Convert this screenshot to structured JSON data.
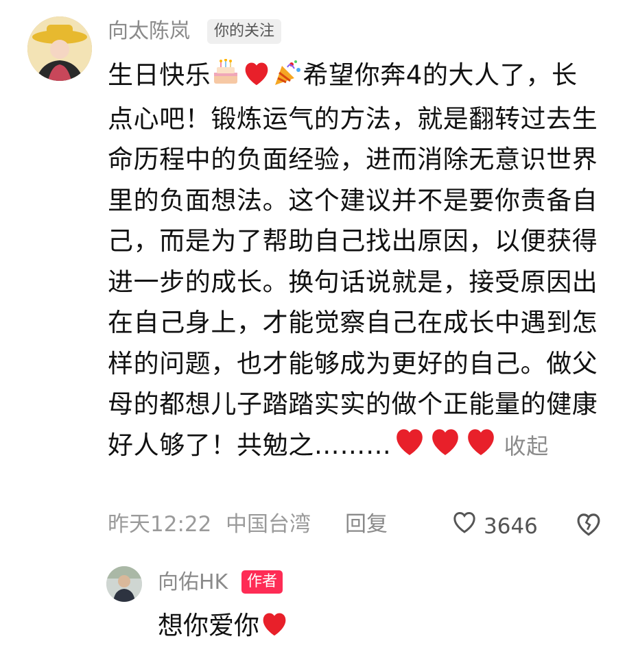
{
  "main_comment": {
    "username": "向太陈岚",
    "follow_badge": "你的关注",
    "text_part1": "生日快乐",
    "text_part2": "希望你奔4的大人了，长点心吧！锻炼运气的方法，就是翻转过去生命历程中的负面经验，进而消除无意识世界里的负面想法。这个建议并不是要你责备自己，而是为了帮助自己找出原因，以便获得进一步的成长。换句话说就是，接受原因出在自己身上，才能觉察自己在成长中遇到怎样的问题，也才能够成为更好的自己。做父母的都想儿子踏踏实实的做个正能量的健康好人够了！共勉之………",
    "collapse_label": "收起",
    "timestamp": "昨天12:22",
    "location": "中国台湾",
    "reply_label": "回复",
    "like_count": "3646",
    "icons": [
      "cake-icon",
      "heart-icon",
      "party-popper-icon",
      "heart-icon",
      "heart-icon",
      "heart-icon",
      "like-heart-icon",
      "dislike-broken-heart-icon"
    ]
  },
  "reply": {
    "username": "向佑HK",
    "author_badge": "作者",
    "text": "想你爱你"
  },
  "colors": {
    "heart": "#e8202a",
    "author_badge": "#fe2c55",
    "meta_text": "#9a9a9a"
  }
}
